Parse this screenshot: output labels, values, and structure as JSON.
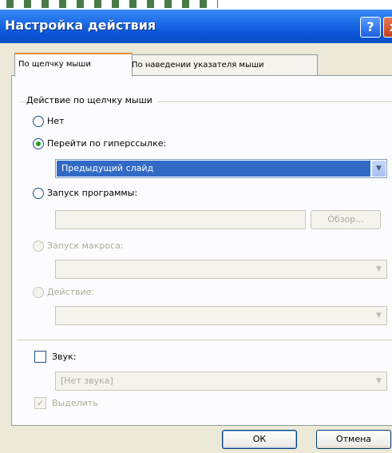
{
  "window": {
    "title": "Настройка действия",
    "help_icon": "?",
    "close_icon": "x"
  },
  "tabs": [
    {
      "label": "По щелчку мыши",
      "active": true
    },
    {
      "label": "По наведении указателя мыши",
      "active": false
    }
  ],
  "group": {
    "label": "Действие по щелчку мыши"
  },
  "options": {
    "none": "Нет",
    "hyperlink": "Перейти по гиперссылке:",
    "hyperlink_value": "Предыдущий слайд",
    "run_program": "Запуск программы:",
    "browse_label": "Обзор...",
    "run_macro": "Запуск макроса:",
    "action": "Действие:"
  },
  "sound": {
    "label": "Звук:",
    "value": "[Нет звука]",
    "highlight_label": "Выделить",
    "highlight_check": "✓"
  },
  "buttons": {
    "ok": "ОК",
    "cancel": "Отмена"
  },
  "colors": {
    "titlebar": "#0b55d8",
    "dialog_bg": "#ece9d8",
    "selection": "#316ac5",
    "radio_checked": "#21a121"
  }
}
